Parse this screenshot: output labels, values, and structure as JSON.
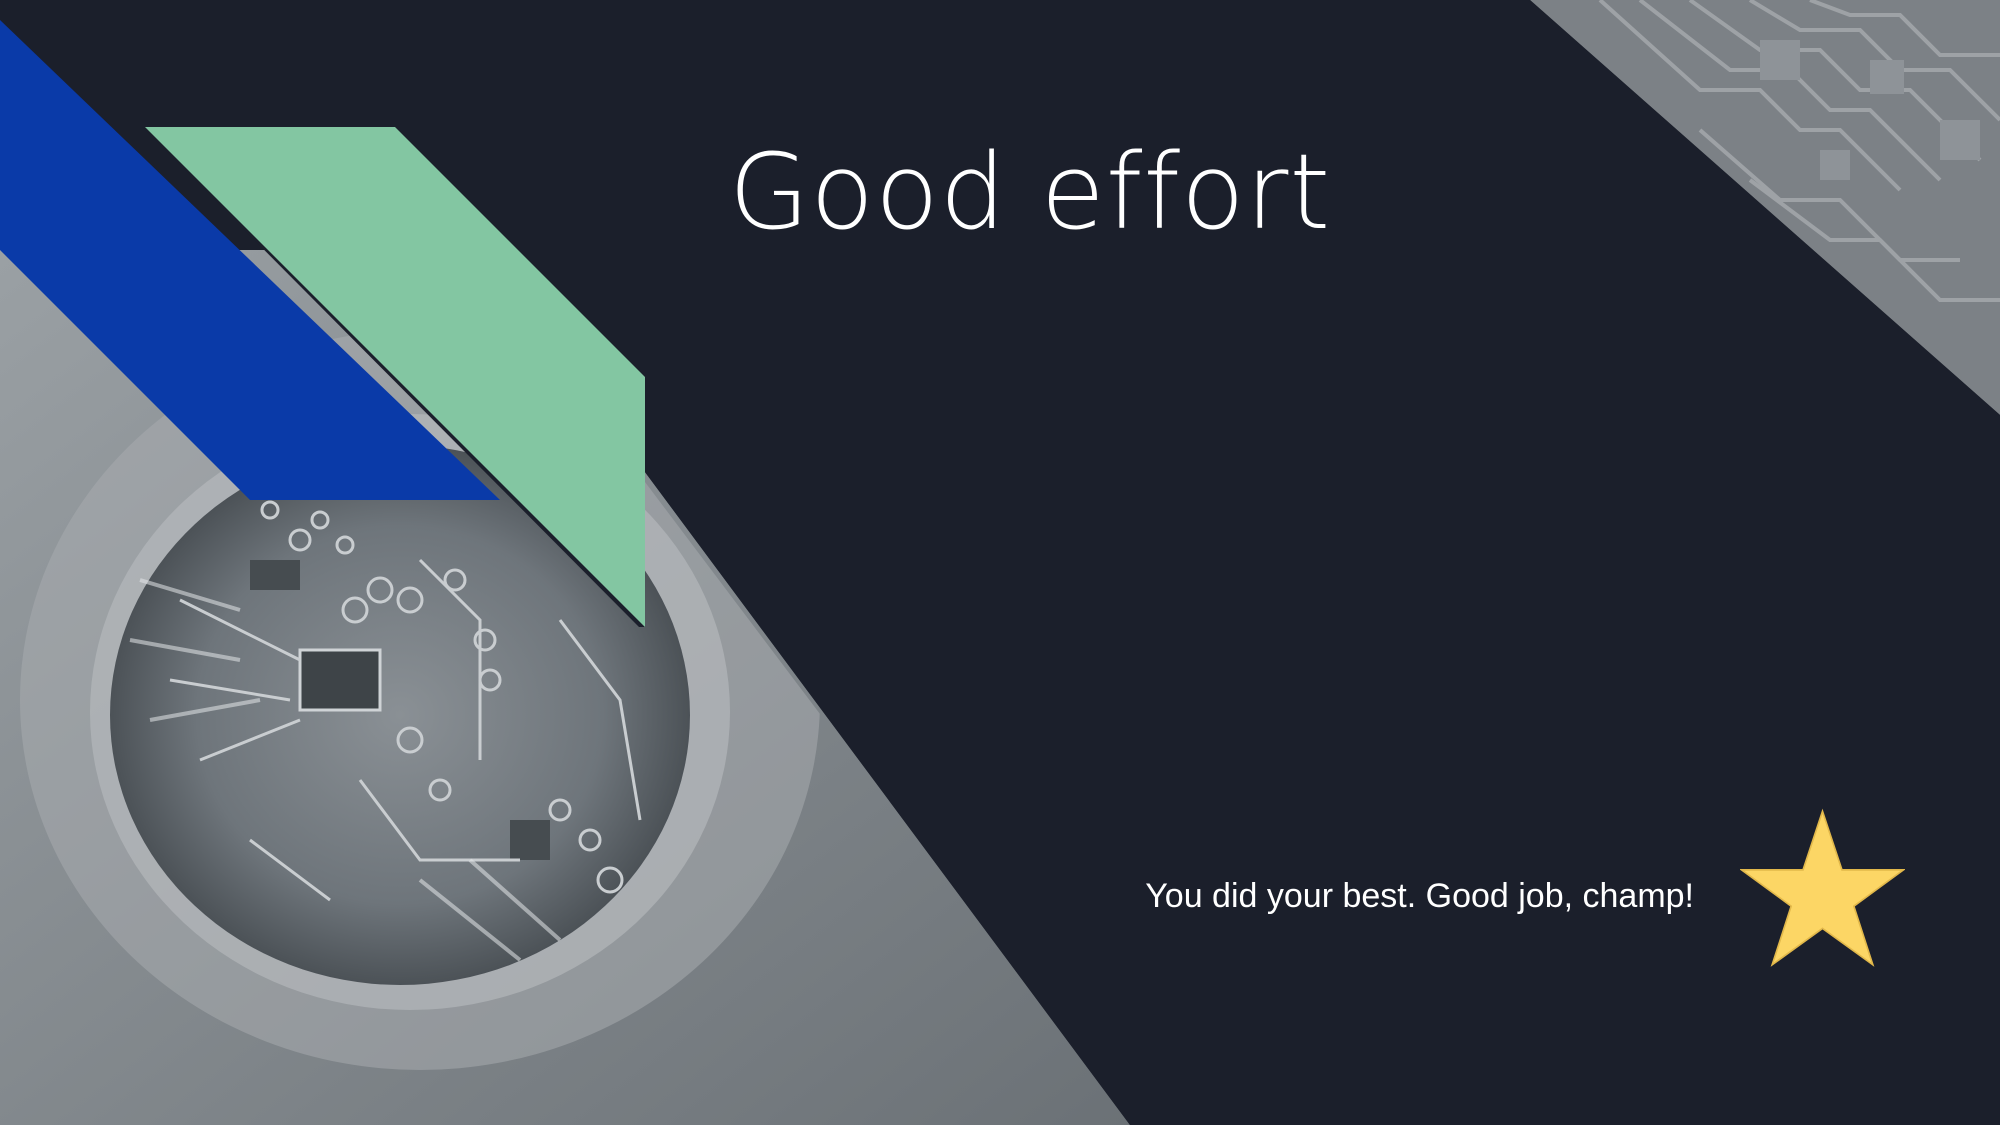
{
  "slide": {
    "title": "Good effort",
    "subtitle": "You did your best. Good job, champ!"
  },
  "icons": {
    "star": "star-icon",
    "circuit_photo": "circuit-board-lens-image",
    "circuit_texture": "circuit-pattern-image"
  },
  "colors": {
    "background": "#1b1f2b",
    "blue_band": "#0a3aa8",
    "green_band": "#83c6a2",
    "star": "#fcd665",
    "text": "#ffffff"
  }
}
